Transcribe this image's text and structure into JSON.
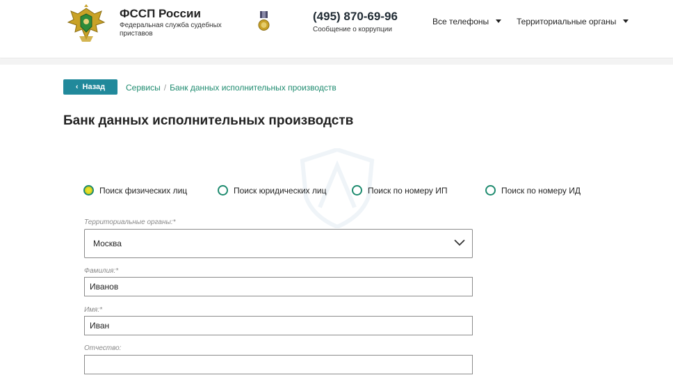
{
  "header": {
    "brand_title": "ФССП России",
    "brand_subtitle": "Федеральная служба судебных приставов",
    "phone": "(495) 870-69-96",
    "phone_caption": "Сообщение о коррупции",
    "nav": [
      {
        "label": "Все телефоны"
      },
      {
        "label": "Территориальные органы"
      }
    ]
  },
  "breadcrumb": {
    "back_label": "Назад",
    "items": [
      "Сервисы",
      "Банк данных исполнительных производств"
    ]
  },
  "page_title": "Банк данных исполнительных производств",
  "search_modes": [
    {
      "label": "Поиск физических лиц",
      "checked": true
    },
    {
      "label": "Поиск юридических лиц",
      "checked": false
    },
    {
      "label": "Поиск по номеру ИП",
      "checked": false
    },
    {
      "label": "Поиск по номеру ИД",
      "checked": false
    }
  ],
  "form": {
    "region": {
      "label": "Территориальные органы:*",
      "value": "Москва"
    },
    "last_name": {
      "label": "Фамилия:*",
      "value": "Иванов"
    },
    "first_name": {
      "label": "Имя:*",
      "value": "Иван"
    },
    "patronymic": {
      "label": "Отчество:",
      "value": ""
    }
  },
  "colors": {
    "accent": "#21899b",
    "link": "#1e8b6f",
    "radio_selected": "#e8e22a"
  }
}
